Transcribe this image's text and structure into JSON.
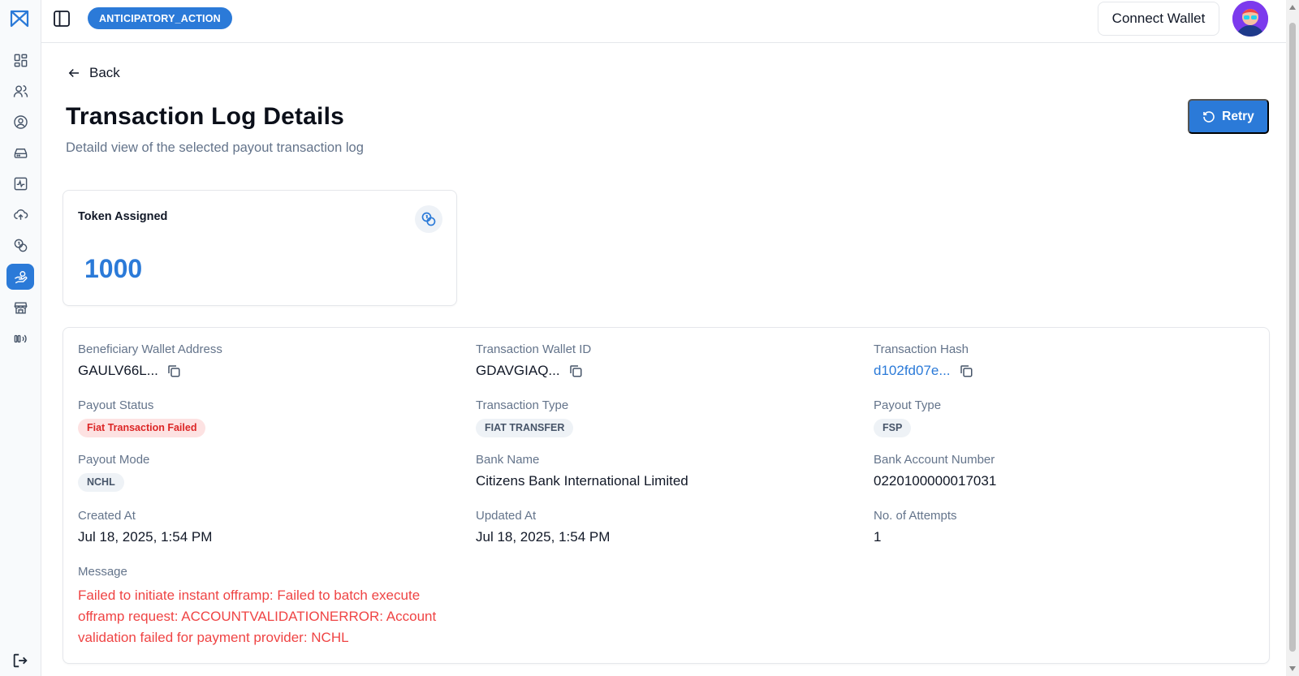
{
  "header": {
    "project_badge": "ANTICIPATORY_ACTION",
    "connect_wallet_label": "Connect Wallet"
  },
  "sidebar": {
    "items": [
      {
        "icon": "dashboard-icon"
      },
      {
        "icon": "users-icon"
      },
      {
        "icon": "user-circle-icon"
      },
      {
        "icon": "hard-drive-icon"
      },
      {
        "icon": "activity-icon"
      },
      {
        "icon": "cloud-upload-icon"
      },
      {
        "icon": "coins-icon"
      },
      {
        "icon": "hand-coins-icon",
        "active": true
      },
      {
        "icon": "store-icon"
      },
      {
        "icon": "broadcast-icon"
      }
    ],
    "bottom_icon": "logout-icon"
  },
  "page": {
    "back_label": "Back",
    "title": "Transaction Log Details",
    "subtitle": "Detaild view of the selected payout transaction log",
    "retry_label": "Retry"
  },
  "token_card": {
    "label": "Token Assigned",
    "value": "1000"
  },
  "details": {
    "beneficiary_wallet_address": {
      "label": "Beneficiary Wallet Address",
      "value": "GAULV66L..."
    },
    "transaction_wallet_id": {
      "label": "Transaction Wallet ID",
      "value": "GDAVGIAQ..."
    },
    "transaction_hash": {
      "label": "Transaction Hash",
      "value": "d102fd07e..."
    },
    "payout_status": {
      "label": "Payout Status",
      "value": "Fiat Transaction Failed"
    },
    "transaction_type": {
      "label": "Transaction Type",
      "value": "FIAT TRANSFER"
    },
    "payout_type": {
      "label": "Payout Type",
      "value": "FSP"
    },
    "payout_mode": {
      "label": "Payout Mode",
      "value": "NCHL"
    },
    "bank_name": {
      "label": "Bank Name",
      "value": "Citizens Bank International Limited"
    },
    "bank_account_number": {
      "label": "Bank Account Number",
      "value": "0220100000017031"
    },
    "created_at": {
      "label": "Created At",
      "value": "Jul 18, 2025, 1:54 PM"
    },
    "updated_at": {
      "label": "Updated At",
      "value": "Jul 18, 2025, 1:54 PM"
    },
    "attempts": {
      "label": "No. of Attempts",
      "value": "1"
    },
    "message": {
      "label": "Message",
      "value": "Failed to initiate instant offramp: Failed to batch execute offramp request: ACCOUNTVALIDATIONERROR: Account validation failed for payment provider: NCHL"
    }
  },
  "colors": {
    "accent": "#2b7ad8",
    "error": "#ef4444",
    "badge_red_bg": "#fde2e2",
    "badge_gray_bg": "#eef2f6"
  }
}
